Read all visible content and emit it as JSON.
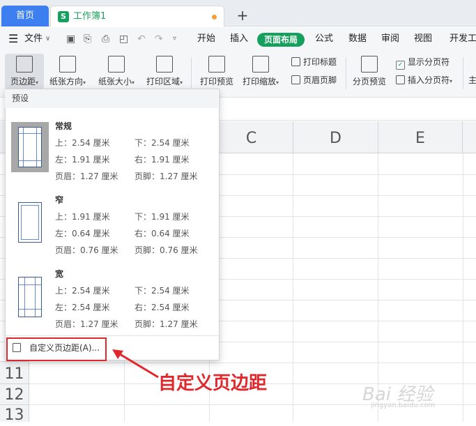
{
  "tabs": {
    "home": "首页",
    "workbook": "工作簿1",
    "workbook_icon": "S",
    "new_tab": "+"
  },
  "menubar": {
    "file": "文件",
    "items": [
      "开始",
      "插入",
      "页面布局",
      "公式",
      "数据",
      "审阅",
      "视图",
      "开发工"
    ],
    "active": "页面布局",
    "accent": "#17a05d"
  },
  "ribbon": {
    "margins": "页边距",
    "orientation": "纸张方向",
    "size": "纸张大小",
    "print_area": "打印区域",
    "print_preview": "打印预览",
    "print_scale": "打印缩放",
    "print_titles": "打印标题",
    "header_footer": "页眉页脚",
    "page_break_preview": "分页预览",
    "show_page_breaks": "显示分页符",
    "insert_page_break": "插入分页符",
    "more": "主"
  },
  "columns": [
    "C",
    "D",
    "E"
  ],
  "rows": [
    "11",
    "12",
    "13"
  ],
  "dropdown": {
    "header": "预设",
    "presets": [
      {
        "name": "常规",
        "top": "上：2.54 厘米",
        "bottom": "下：2.54 厘米",
        "left": "左：1.91 厘米",
        "right": "右：1.91 厘米",
        "header": "页眉：1.27 厘米",
        "footer": "页脚：1.27 厘米"
      },
      {
        "name": "窄",
        "top": "上：1.91 厘米",
        "bottom": "下：1.91 厘米",
        "left": "左：0.64 厘米",
        "right": "右：0.64 厘米",
        "header": "页眉：0.76 厘米",
        "footer": "页脚：0.76 厘米"
      },
      {
        "name": "宽",
        "top": "上：2.54 厘米",
        "bottom": "下：2.54 厘米",
        "left": "左：2.54 厘米",
        "right": "右：2.54 厘米",
        "header": "页眉：1.27 厘米",
        "footer": "页脚：1.27 厘米"
      }
    ],
    "custom": "自定义页边距(A)..."
  },
  "annotation": "自定义页边距",
  "watermark": {
    "text": "Bai 经验",
    "sub": "jingyan.baidu.com"
  },
  "colors": {
    "home_tab": "#3d7ff0",
    "highlight": "#e0272c"
  }
}
